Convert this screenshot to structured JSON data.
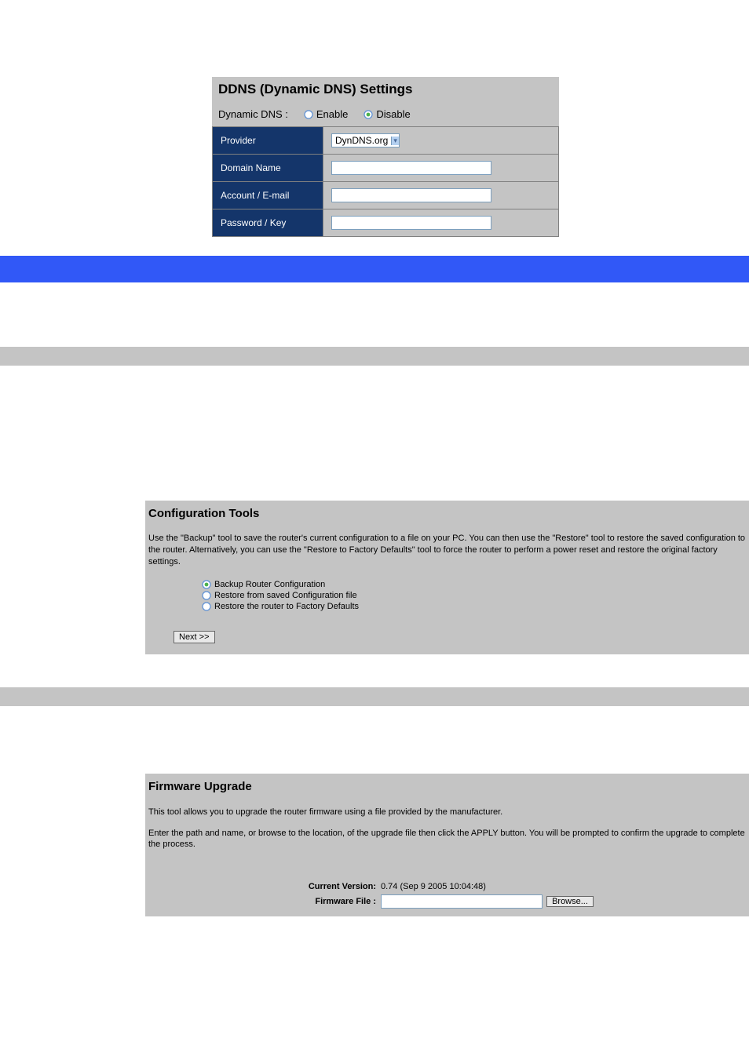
{
  "ddns": {
    "title": "DDNS (Dynamic DNS) Settings",
    "label": "Dynamic DNS :",
    "enable_label": "Enable",
    "disable_label": "Disable",
    "selected": "disable",
    "rows": {
      "provider": {
        "label": "Provider",
        "value": "DynDNS.org"
      },
      "domain": {
        "label": "Domain Name",
        "value": ""
      },
      "account": {
        "label": "Account / E-mail",
        "value": ""
      },
      "password": {
        "label": "Password / Key",
        "value": ""
      }
    }
  },
  "config_tools": {
    "title": "Configuration Tools",
    "description": "Use the \"Backup\" tool to save the router's current configuration to a file on your PC. You can then use the \"Restore\" tool to restore the saved configuration to the router.  Alternatively, you can use the \"Restore to Factory Defaults\" tool to force the router to perform a power reset and restore the original factory settings.",
    "options": {
      "backup": "Backup Router Configuration",
      "restore_file": "Restore from saved Configuration file",
      "factory": "Restore the router to Factory Defaults"
    },
    "selected": "backup",
    "next_button": "Next >>"
  },
  "firmware": {
    "title": "Firmware Upgrade",
    "desc1": "This tool allows you to upgrade the router firmware using a file provided by the manufacturer.",
    "desc2": "Enter the path and name, or browse to the location, of the upgrade file then click the APPLY button. You will be prompted to confirm the upgrade to complete the process.",
    "current_version_label": "Current Version:",
    "current_version_value": "0.74 (Sep 9 2005 10:04:48)",
    "file_label": "Firmware File :",
    "file_value": "",
    "browse_button": "Browse..."
  }
}
